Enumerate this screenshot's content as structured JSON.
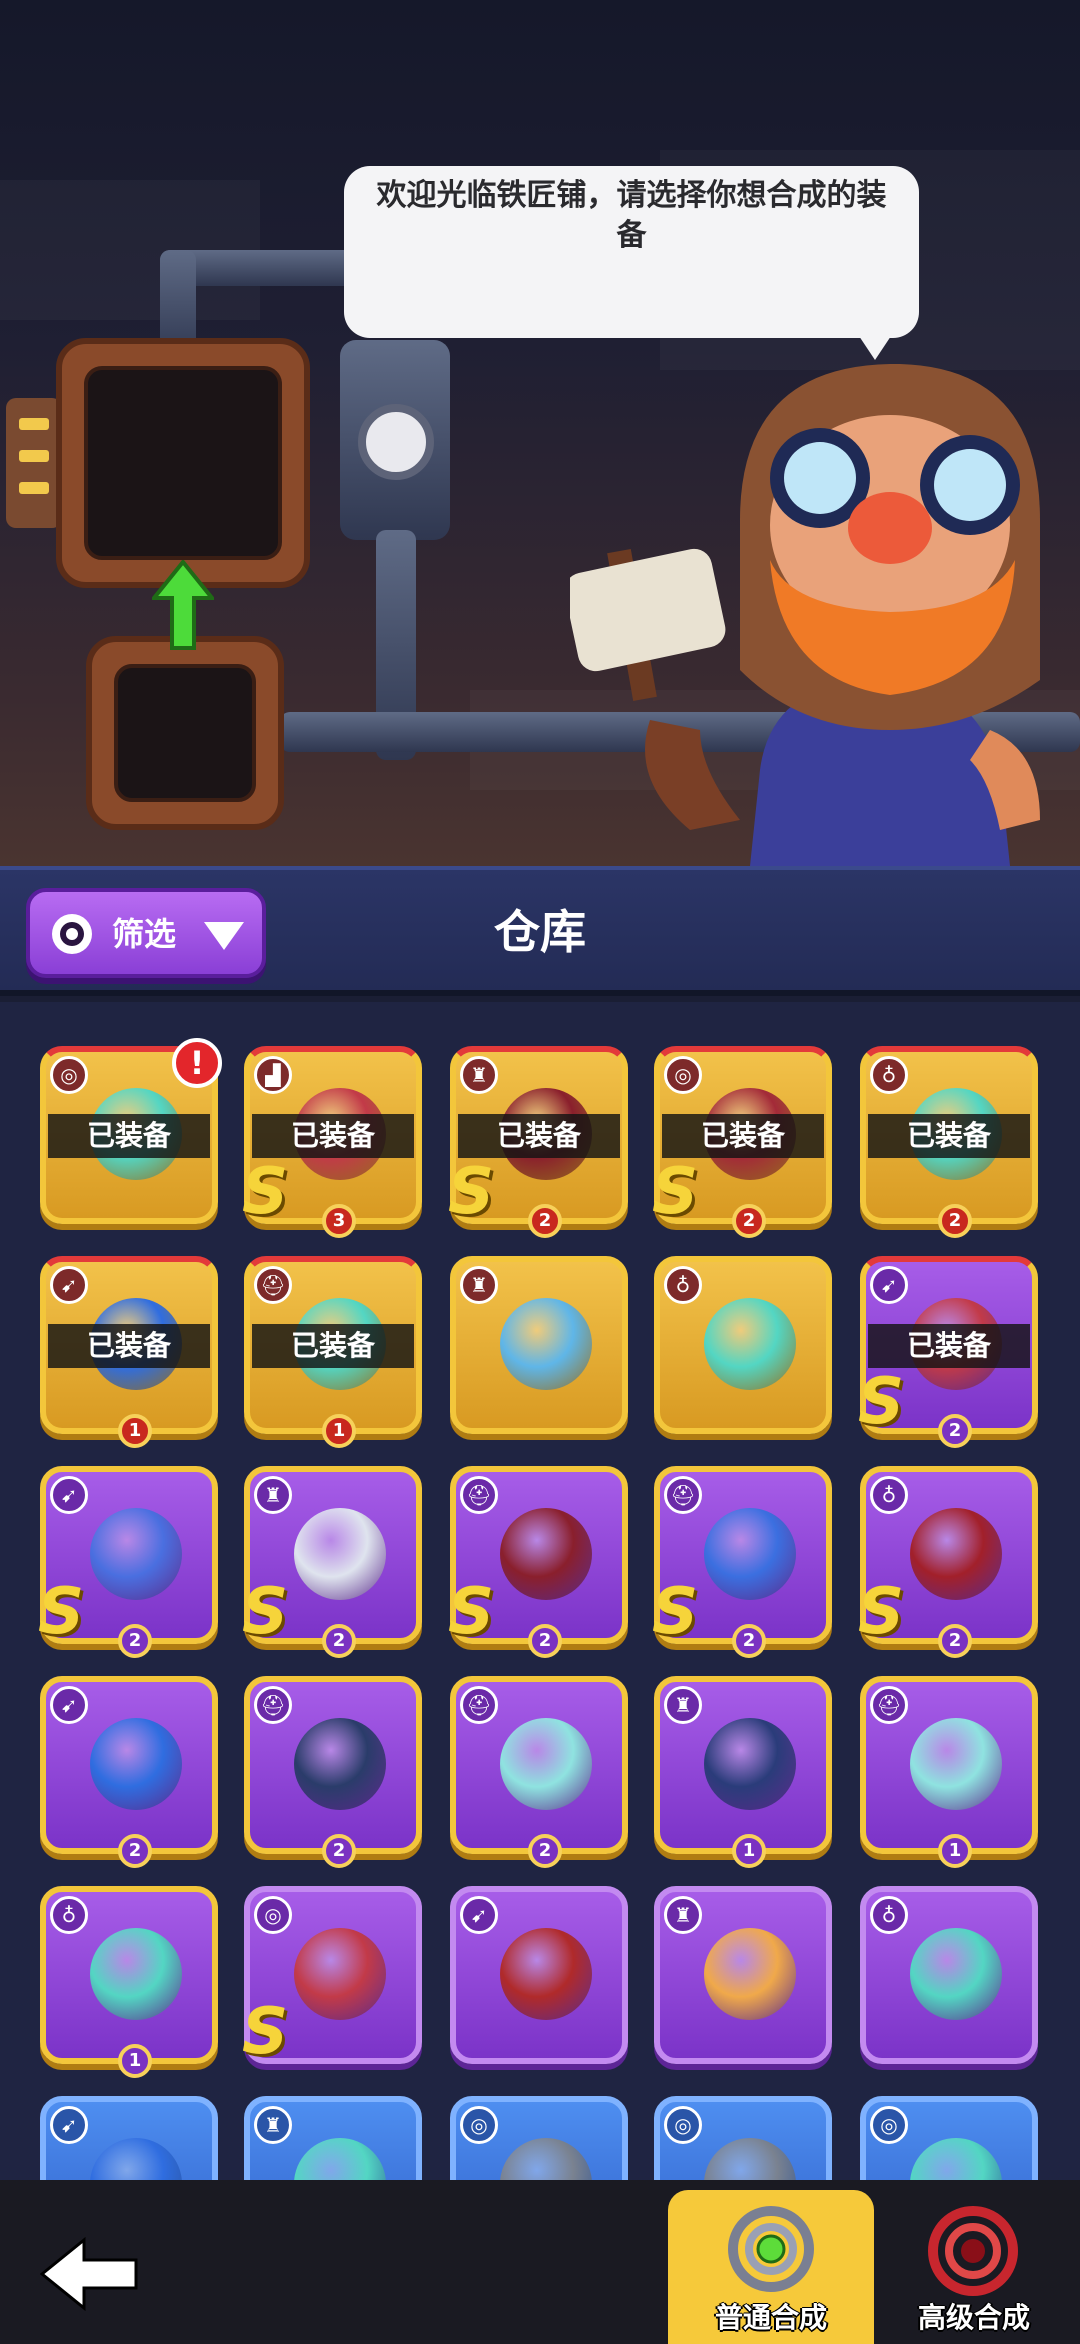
{
  "scene": {
    "speech": "欢迎光临铁匠铺，请选择你想合成的装备"
  },
  "header": {
    "filter_label": "筛选",
    "title": "仓库"
  },
  "inventory": {
    "equipped_label": "已装备",
    "alert_mark": "!",
    "rank_mark": "S",
    "rows": [
      [
        {
          "type": "ring-icon",
          "style": "gold",
          "equipped": true,
          "rank": "",
          "level": "",
          "alert": true,
          "color": "#53d6c3"
        },
        {
          "type": "boots-icon",
          "style": "gold",
          "equipped": true,
          "rank": "S",
          "level": "3",
          "alert": false,
          "color": "#c23a48"
        },
        {
          "type": "armor-icon",
          "style": "gold",
          "equipped": true,
          "rank": "S",
          "level": "2",
          "alert": false,
          "color": "#8a1f2c"
        },
        {
          "type": "ring-icon",
          "style": "gold",
          "equipped": true,
          "rank": "S",
          "level": "2",
          "alert": false,
          "color": "#a32a38"
        },
        {
          "type": "amulet-icon",
          "style": "gold",
          "equipped": true,
          "rank": "",
          "level": "2",
          "alert": false,
          "color": "#53d6c3"
        }
      ],
      [
        {
          "type": "bow-icon",
          "style": "gold",
          "equipped": true,
          "rank": "",
          "level": "1",
          "alert": false,
          "color": "#2f6de0"
        },
        {
          "type": "helmet-icon",
          "style": "gold",
          "equipped": true,
          "rank": "",
          "level": "1",
          "alert": false,
          "color": "#53d6c3"
        },
        {
          "type": "armor-icon",
          "style": "gold",
          "equipped": false,
          "rank": "",
          "level": "",
          "alert": false,
          "color": "#5fb6e8"
        },
        {
          "type": "amulet-icon",
          "style": "gold",
          "equipped": false,
          "rank": "",
          "level": "",
          "alert": false,
          "color": "#53d6c3"
        },
        {
          "type": "bow-icon",
          "style": "purple",
          "equipped": true,
          "rank": "S",
          "level": "2",
          "alert": false,
          "color": "#c23a48"
        }
      ],
      [
        {
          "type": "bow-icon",
          "style": "purple",
          "equipped": false,
          "rank": "S",
          "level": "2",
          "alert": false,
          "color": "#4a6fe0"
        },
        {
          "type": "armor-icon",
          "style": "purple",
          "equipped": false,
          "rank": "S",
          "level": "2",
          "alert": false,
          "color": "#dfe4ee"
        },
        {
          "type": "helmet-icon",
          "style": "purple",
          "equipped": false,
          "rank": "S",
          "level": "2",
          "alert": false,
          "color": "#8a1f2c"
        },
        {
          "type": "helmet-icon",
          "style": "purple",
          "equipped": false,
          "rank": "S",
          "level": "2",
          "alert": false,
          "color": "#3b6fe0"
        },
        {
          "type": "amulet-icon",
          "style": "purple",
          "equipped": false,
          "rank": "S",
          "level": "2",
          "alert": false,
          "color": "#a2202a"
        }
      ],
      [
        {
          "type": "bow-icon",
          "style": "purple",
          "equipped": false,
          "rank": "",
          "level": "2",
          "alert": false,
          "color": "#2f6de0"
        },
        {
          "type": "helmet-icon",
          "style": "purple",
          "equipped": false,
          "rank": "",
          "level": "2",
          "alert": false,
          "color": "#2a3c6a"
        },
        {
          "type": "helmet-icon",
          "style": "purple",
          "equipped": false,
          "rank": "",
          "level": "2",
          "alert": false,
          "color": "#8fe3e0"
        },
        {
          "type": "armor-icon",
          "style": "purple",
          "equipped": false,
          "rank": "",
          "level": "1",
          "alert": false,
          "color": "#2a3c7a"
        },
        {
          "type": "helmet-icon",
          "style": "purple",
          "equipped": false,
          "rank": "",
          "level": "1",
          "alert": false,
          "color": "#8fe3e0"
        }
      ],
      [
        {
          "type": "amulet-icon",
          "style": "purple",
          "equipped": false,
          "rank": "",
          "level": "1",
          "alert": false,
          "color": "#53d6c3"
        },
        {
          "type": "ring-icon",
          "style": "purple-plain",
          "equipped": false,
          "rank": "S",
          "level": "",
          "alert": false,
          "color": "#c23a48"
        },
        {
          "type": "bow-icon",
          "style": "purple-plain",
          "equipped": false,
          "rank": "",
          "level": "",
          "alert": false,
          "color": "#b02a2a"
        },
        {
          "type": "armor-icon",
          "style": "purple-plain",
          "equipped": false,
          "rank": "",
          "level": "",
          "alert": false,
          "color": "#f0a94a"
        },
        {
          "type": "amulet-icon",
          "style": "purple-plain",
          "equipped": false,
          "rank": "",
          "level": "",
          "alert": false,
          "color": "#53d6c3"
        }
      ],
      [
        {
          "type": "bow-icon",
          "style": "blue",
          "equipped": false,
          "rank": "",
          "level": "",
          "alert": false,
          "color": "#2f6de0"
        },
        {
          "type": "armor-icon",
          "style": "blue",
          "equipped": false,
          "rank": "",
          "level": "",
          "alert": false,
          "color": "#53d6c3"
        },
        {
          "type": "ring-icon",
          "style": "blue",
          "equipped": false,
          "rank": "",
          "level": "",
          "alert": false,
          "color": "#7a8290"
        },
        {
          "type": "ring-icon",
          "style": "blue",
          "equipped": false,
          "rank": "",
          "level": "",
          "alert": false,
          "color": "#7a8290"
        },
        {
          "type": "ring-icon",
          "style": "blue",
          "equipped": false,
          "rank": "",
          "level": "",
          "alert": false,
          "color": "#53d6c3"
        }
      ]
    ]
  },
  "bottom": {
    "normal_merge_label": "普通合成",
    "advanced_merge_label": "高级合成"
  },
  "colors": {
    "gold": "#f2c24a",
    "purple": "#a75de8",
    "blue": "#4e8ef0",
    "header": "#2b3566",
    "filter_button": "#b86cf2",
    "normal_merge_bg": "#f6c93a"
  }
}
